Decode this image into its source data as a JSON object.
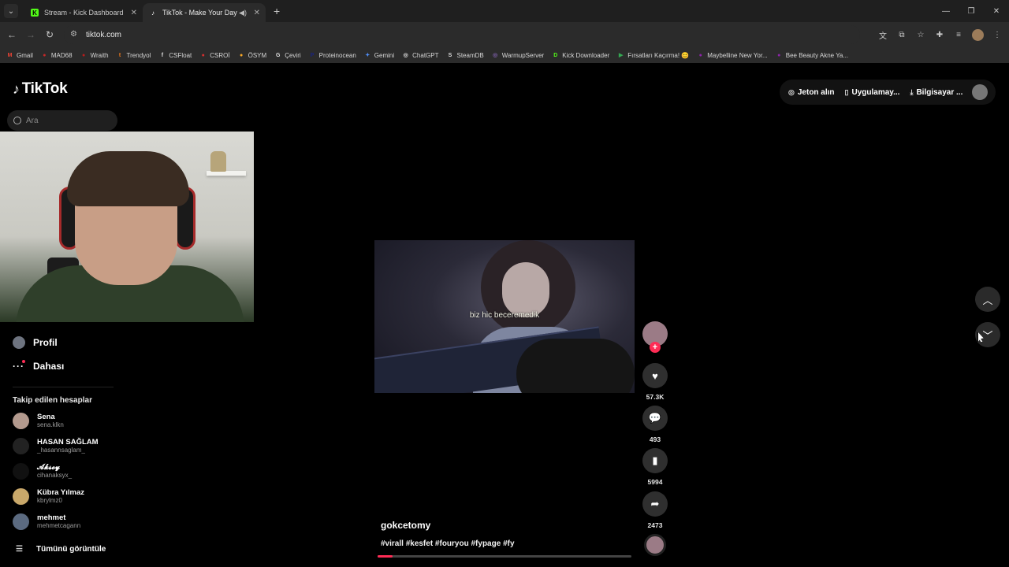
{
  "browser": {
    "tabs": [
      {
        "title": "Stream - Kick Dashboard",
        "favicon": "kick-icon",
        "color": "#53fc18"
      },
      {
        "title": "TikTok - Make Your Day",
        "favicon": "tiktok-icon",
        "active": true,
        "audio": true
      }
    ],
    "url": "tiktok.com",
    "bookmarks": [
      {
        "label": "Gmail",
        "color": "#ea4335",
        "icon": "M"
      },
      {
        "label": "MAD68",
        "color": "#c62828",
        "icon": "●"
      },
      {
        "label": "Wraith",
        "color": "#b71c1c",
        "icon": "●"
      },
      {
        "label": "Trendyol",
        "color": "#f27a1a",
        "icon": "t"
      },
      {
        "label": "CSFloat",
        "color": "#dddddd",
        "icon": "f"
      },
      {
        "label": "CSROİ",
        "color": "#d32f2f",
        "icon": "●"
      },
      {
        "label": "ÖSYM",
        "color": "#f9a825",
        "icon": "●"
      },
      {
        "label": "Çeviri",
        "color": "#e0e0e0",
        "icon": "G"
      },
      {
        "label": "Proteinocean",
        "color": "#1a237e",
        "icon": "P"
      },
      {
        "label": "Gemini",
        "color": "#4f8df5",
        "icon": "✦"
      },
      {
        "label": "ChatGPT",
        "color": "#dddddd",
        "icon": "◎"
      },
      {
        "label": "SteamDB",
        "color": "#dddddd",
        "icon": "S"
      },
      {
        "label": "WarmupServer",
        "color": "#7b5ea7",
        "icon": "◎"
      },
      {
        "label": "Kick Downloader",
        "color": "#53fc18",
        "icon": "D"
      },
      {
        "label": "Fırsatları Kaçırma! 😊",
        "color": "#34a853",
        "icon": "▶"
      },
      {
        "label": "Maybelline New Yor...",
        "color": "#8e24aa",
        "icon": "●"
      },
      {
        "label": "Bee Beauty Akne Ya...",
        "color": "#8e24aa",
        "icon": "●"
      }
    ]
  },
  "tiktok": {
    "logo": "TikTok",
    "search_placeholder": "Ara",
    "nav": {
      "profile": "Profil",
      "more": "Dahası"
    },
    "following_title": "Takip edilen hesaplar",
    "following": [
      {
        "name": "Sena",
        "handle": "sena.klkn",
        "color": "#b39a8e"
      },
      {
        "name": "HASAN SAĞLAM",
        "handle": "_hasannsaglam_",
        "color": "#222222"
      },
      {
        "name": "𝓐𝓴𝓼𝓸𝔂",
        "handle": "cihanaksyx_",
        "color": "#111111"
      },
      {
        "name": "Kübra Yılmaz",
        "handle": "kbrylmz0",
        "color": "#c9a86a"
      },
      {
        "name": "mehmet",
        "handle": "mehmetcagann",
        "color": "#5b6a80"
      }
    ],
    "view_all": "Tümünü görüntüle",
    "top_actions": {
      "coins": "Jeton alın",
      "app": "Uygulamay...",
      "pc": "Bilgisayar ..."
    },
    "video": {
      "caption_overlay": "biz hic beceremedik",
      "author": "gokcetomy",
      "hashtags": "#virall #kesfet #fouryou #fypage #fy",
      "likes": "57.3K",
      "comments": "493",
      "saves": "5994",
      "shares": "2473",
      "progress": 0.06
    }
  }
}
